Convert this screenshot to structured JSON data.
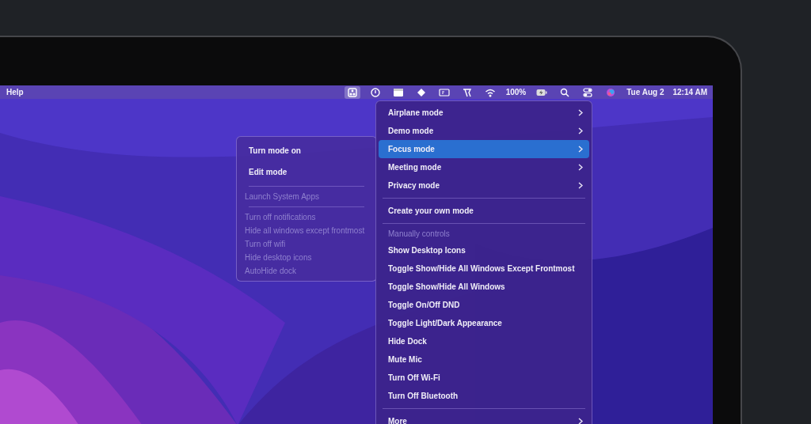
{
  "menu_bar": {
    "app_menus": [
      "Help"
    ],
    "status_items": [
      {
        "kind": "icon",
        "selected": true
      },
      {
        "kind": "icon",
        "selected": false
      },
      {
        "kind": "icon",
        "selected": false
      },
      {
        "kind": "icon",
        "selected": false
      },
      {
        "kind": "icon",
        "selected": false
      },
      {
        "kind": "icon",
        "selected": false
      },
      {
        "kind": "icon",
        "selected": false
      },
      {
        "kind": "text",
        "text": "100%",
        "selected": false
      },
      {
        "kind": "icon",
        "selected": false
      },
      {
        "kind": "icon",
        "selected": false
      },
      {
        "kind": "icon",
        "selected": false
      },
      {
        "kind": "icon",
        "selected": false
      },
      {
        "kind": "text",
        "text": "Tue Aug 2",
        "selected": false
      },
      {
        "kind": "text",
        "text": "12:14 AM",
        "selected": false
      }
    ]
  },
  "submenu": [
    {
      "kind": "item",
      "label": "Turn mode on",
      "disabled": false
    },
    {
      "kind": "item",
      "label": "Edit mode",
      "disabled": false
    },
    {
      "kind": "separator"
    },
    {
      "kind": "item",
      "label": "Launch System Apps",
      "disabled": true
    },
    {
      "kind": "separator"
    },
    {
      "kind": "item",
      "label": "Turn off notifications",
      "disabled": true
    },
    {
      "kind": "item",
      "label": "Hide all windows except frontmost",
      "disabled": true
    },
    {
      "kind": "item",
      "label": "Turn off wifi",
      "disabled": true
    },
    {
      "kind": "item",
      "label": "Hide desktop icons",
      "disabled": true
    },
    {
      "kind": "item",
      "label": "AutoHide dock",
      "disabled": true
    }
  ],
  "menu": [
    {
      "kind": "submenu",
      "label": "Airplane mode",
      "selected": false
    },
    {
      "kind": "submenu",
      "label": "Demo mode",
      "selected": false
    },
    {
      "kind": "submenu",
      "label": "Focus mode",
      "selected": true
    },
    {
      "kind": "submenu",
      "label": "Meeting mode",
      "selected": false
    },
    {
      "kind": "submenu",
      "label": "Privacy mode",
      "selected": false
    },
    {
      "kind": "separator"
    },
    {
      "kind": "item",
      "label": "Create your own mode",
      "selected": false
    },
    {
      "kind": "separator"
    },
    {
      "kind": "header",
      "label": "Manually controls"
    },
    {
      "kind": "item",
      "label": "Show Desktop Icons",
      "selected": false
    },
    {
      "kind": "item",
      "label": "Toggle Show/Hide All Windows Except Frontmost",
      "selected": false
    },
    {
      "kind": "item",
      "label": "Toggle Show/Hide All Windows",
      "selected": false
    },
    {
      "kind": "item",
      "label": "Toggle On/Off DND",
      "selected": false
    },
    {
      "kind": "item",
      "label": "Toggle Light/Dark Appearance",
      "selected": false
    },
    {
      "kind": "item",
      "label": "Hide Dock",
      "selected": false
    },
    {
      "kind": "item",
      "label": "Mute Mic",
      "selected": false
    },
    {
      "kind": "item",
      "label": "Turn Off Wi-Fi",
      "selected": false
    },
    {
      "kind": "item",
      "label": "Turn Off Bluetooth",
      "selected": false
    },
    {
      "kind": "separator"
    },
    {
      "kind": "submenu",
      "label": "More",
      "selected": false
    }
  ]
}
